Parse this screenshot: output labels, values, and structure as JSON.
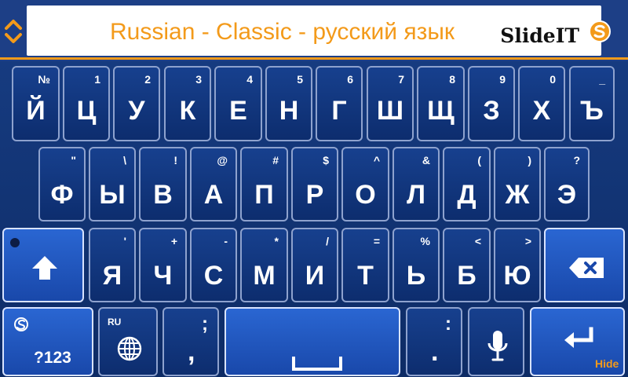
{
  "header": {
    "title": "Russian - Classic - русский язык",
    "brand": "SlideIT"
  },
  "keyboard": {
    "row1": [
      {
        "main": "Й",
        "sub": "№"
      },
      {
        "main": "Ц",
        "sub": "1"
      },
      {
        "main": "У",
        "sub": "2"
      },
      {
        "main": "К",
        "sub": "3"
      },
      {
        "main": "Е",
        "sub": "4"
      },
      {
        "main": "Н",
        "sub": "5"
      },
      {
        "main": "Г",
        "sub": "6"
      },
      {
        "main": "Ш",
        "sub": "7"
      },
      {
        "main": "Щ",
        "sub": "8"
      },
      {
        "main": "З",
        "sub": "9"
      },
      {
        "main": "Х",
        "sub": "0"
      },
      {
        "main": "Ъ",
        "sub": "_"
      }
    ],
    "row2": [
      {
        "main": "Ф",
        "sub": "\""
      },
      {
        "main": "Ы",
        "sub": "\\"
      },
      {
        "main": "В",
        "sub": "!"
      },
      {
        "main": "А",
        "sub": "@"
      },
      {
        "main": "П",
        "sub": "#"
      },
      {
        "main": "Р",
        "sub": "$"
      },
      {
        "main": "О",
        "sub": "^"
      },
      {
        "main": "Л",
        "sub": "&"
      },
      {
        "main": "Д",
        "sub": "("
      },
      {
        "main": "Ж",
        "sub": ")"
      },
      {
        "main": "Э",
        "sub": "?"
      }
    ],
    "row3": [
      {
        "main": "Я",
        "sub": "'"
      },
      {
        "main": "Ч",
        "sub": "+"
      },
      {
        "main": "С",
        "sub": "-"
      },
      {
        "main": "М",
        "sub": "*"
      },
      {
        "main": "И",
        "sub": "/"
      },
      {
        "main": "Т",
        "sub": "="
      },
      {
        "main": "Ь",
        "sub": "%"
      },
      {
        "main": "Б",
        "sub": "<"
      },
      {
        "main": "Ю",
        "sub": ">"
      }
    ],
    "bottom": {
      "mode_label": "?123",
      "lang_label": "RU",
      "semicolon_sub": ";",
      "comma_main": ",",
      "colon_sub": ":",
      "period_main": ".",
      "hide_label": "Hide"
    }
  }
}
